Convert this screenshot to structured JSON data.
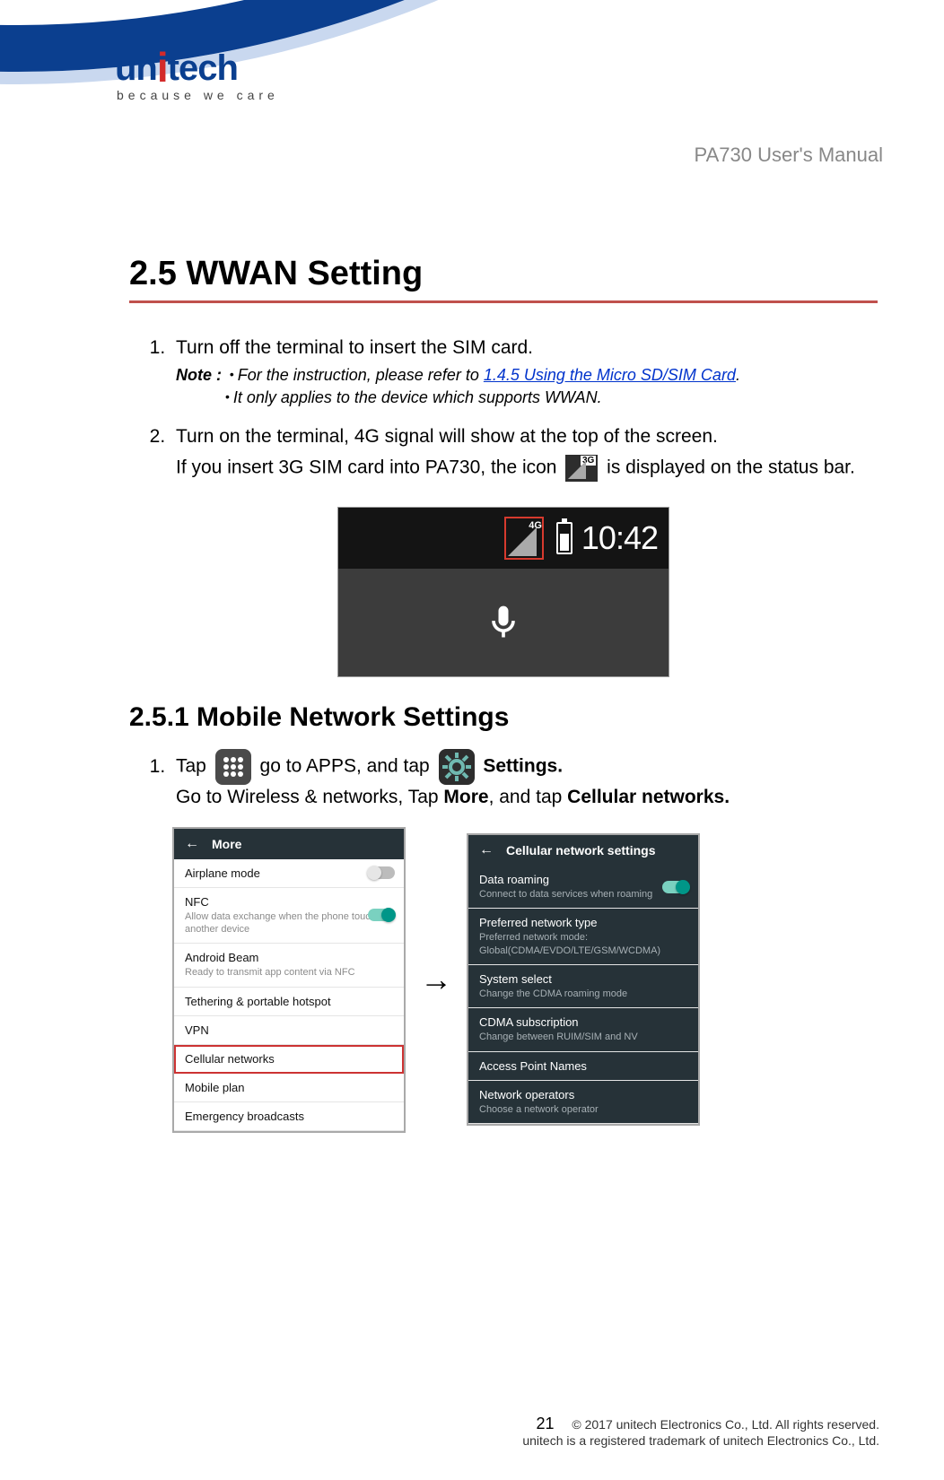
{
  "logo": {
    "brand_prefix": "un",
    "brand_dot_i": "i",
    "brand_suffix": "tech",
    "tagline": "because we care"
  },
  "doc_title": "PA730 User's Manual",
  "section_title": "2.5 WWAN Setting",
  "steps": {
    "s1": {
      "text": "Turn off the terminal to insert the SIM card.",
      "note_label": "Note :",
      "note_a_prefix": "For the instruction, please refer to ",
      "note_a_link": "1.4.5 Using the Micro SD/SIM Card",
      "note_a_suffix": ".",
      "note_b": "It only applies to the device which supports WWAN."
    },
    "s2": {
      "text": "Turn on the terminal, 4G signal will show at the top of the screen.",
      "body_a": "If you insert 3G SIM card into PA730, the icon ",
      "icon_3g_label": "3G",
      "body_b": " is displayed on the status bar."
    }
  },
  "status_bar": {
    "sig_label": "4G",
    "time": "10:42"
  },
  "subsection_title": "2.5.1 Mobile Network Settings",
  "sub_steps": {
    "s1": {
      "a": "Tap ",
      "b": " go to APPS, and tap ",
      "c": " Settings.",
      "d": "Go to Wireless & networks, Tap ",
      "more": "More",
      "e": ", and tap ",
      "cell": "Cellular networks."
    }
  },
  "shot_more": {
    "header": "More",
    "rows": {
      "airplane": {
        "title": "Airplane mode"
      },
      "nfc": {
        "title": "NFC",
        "sub": "Allow data exchange when the phone touches another device"
      },
      "beam": {
        "title": "Android Beam",
        "sub": "Ready to transmit app content via NFC"
      },
      "tether": {
        "title": "Tethering & portable hotspot"
      },
      "vpn": {
        "title": "VPN"
      },
      "cell": {
        "title": "Cellular networks"
      },
      "plan": {
        "title": "Mobile plan"
      },
      "emerg": {
        "title": "Emergency broadcasts"
      }
    }
  },
  "arrow": "→",
  "shot_cell": {
    "header": "Cellular network settings",
    "rows": {
      "roam": {
        "title": "Data roaming",
        "sub": "Connect to data services when roaming"
      },
      "pref": {
        "title": "Preferred network type",
        "sub": "Preferred network mode: Global(CDMA/EVDO/LTE/GSM/WCDMA)"
      },
      "sys": {
        "title": "System select",
        "sub": "Change the CDMA roaming mode"
      },
      "cdma": {
        "title": "CDMA subscription",
        "sub": "Change between RUIM/SIM and NV"
      },
      "apn": {
        "title": "Access Point Names"
      },
      "ops": {
        "title": "Network operators",
        "sub": "Choose a network operator"
      }
    }
  },
  "footer": {
    "page": "21",
    "line1": "© 2017 unitech Electronics Co., Ltd. All rights reserved.",
    "line2": "unitech is a registered trademark of unitech Electronics Co., Ltd."
  }
}
